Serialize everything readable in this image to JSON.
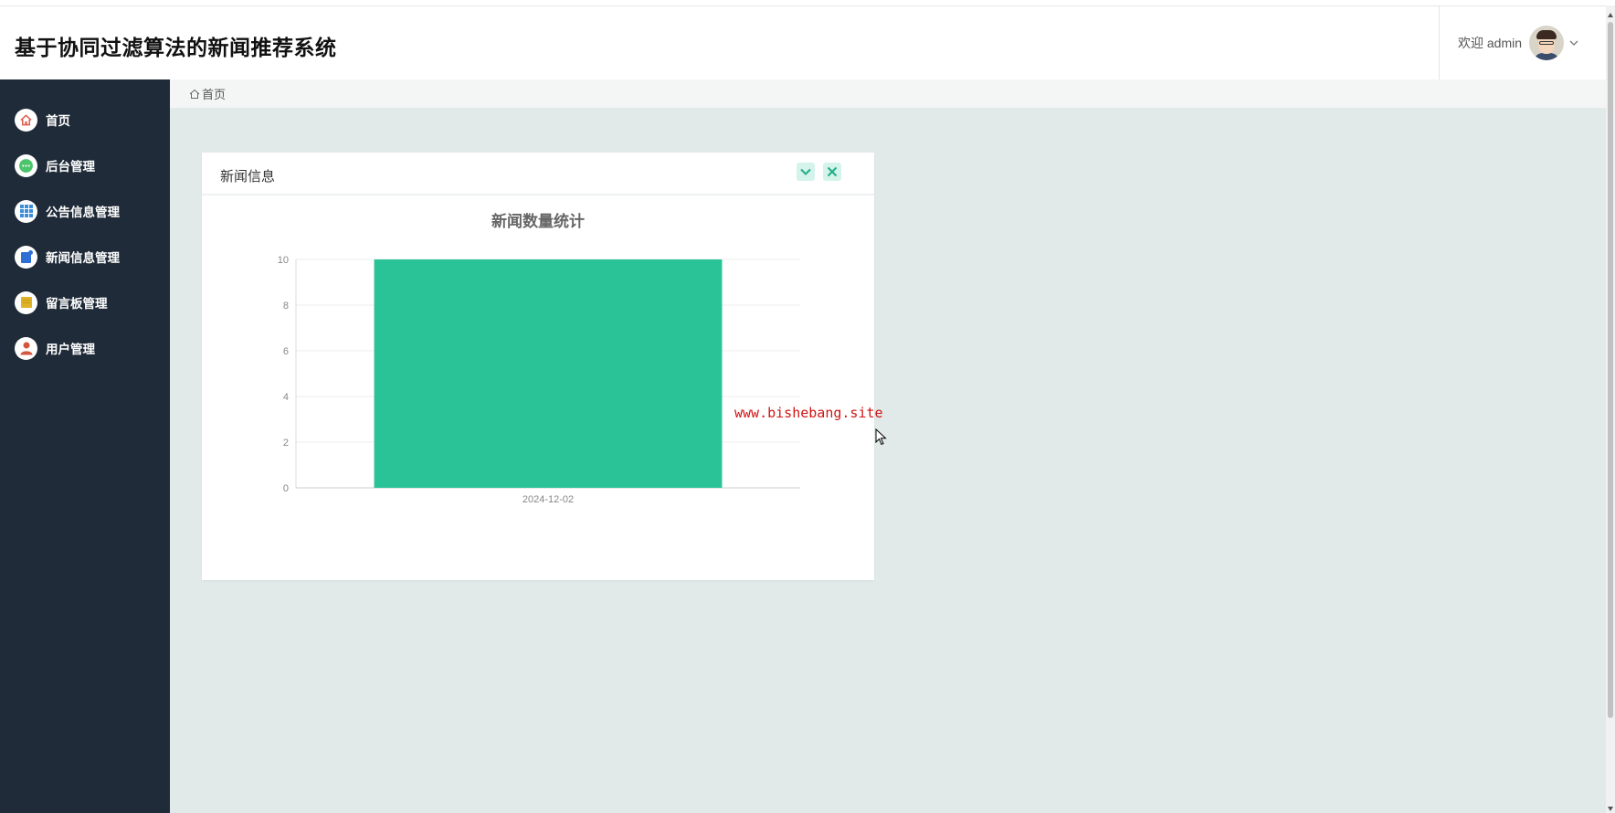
{
  "app": {
    "title": "基于协同过滤算法的新闻推荐系统"
  },
  "header": {
    "welcome_text": "欢迎 admin",
    "avatar_icon": "user-avatar",
    "dropdown_icon": "chevron-down-icon"
  },
  "sidebar": {
    "items": [
      {
        "label": "首页",
        "icon": "home-icon",
        "icon_color": "#e05c4b"
      },
      {
        "label": "后台管理",
        "icon": "chat-bubble-icon",
        "icon_color": "#4cc46b"
      },
      {
        "label": "公告信息管理",
        "icon": "grid-icon",
        "icon_color": "#3a8fd8"
      },
      {
        "label": "新闻信息管理",
        "icon": "document-icon",
        "icon_color": "#2e6fd6"
      },
      {
        "label": "留言板管理",
        "icon": "note-icon",
        "icon_color": "#e0b22a"
      },
      {
        "label": "用户管理",
        "icon": "person-icon",
        "icon_color": "#d4563c"
      }
    ]
  },
  "breadcrumb": {
    "home_label": "首页"
  },
  "card": {
    "title": "新闻信息",
    "collapse_icon": "chevron-down-icon",
    "close_icon": "close-icon",
    "accent_color": "#2ec497"
  },
  "chart_data": {
    "type": "bar",
    "title": "新闻数量统计",
    "categories": [
      "2024-12-02"
    ],
    "values": [
      10
    ],
    "ylim": [
      0,
      10
    ],
    "yticks": [
      0,
      2,
      4,
      6,
      8,
      10
    ],
    "bar_color": "#2ac397",
    "grid": true,
    "xlabel": "",
    "ylabel": ""
  },
  "watermark": {
    "text": "www.bishebang.site"
  }
}
